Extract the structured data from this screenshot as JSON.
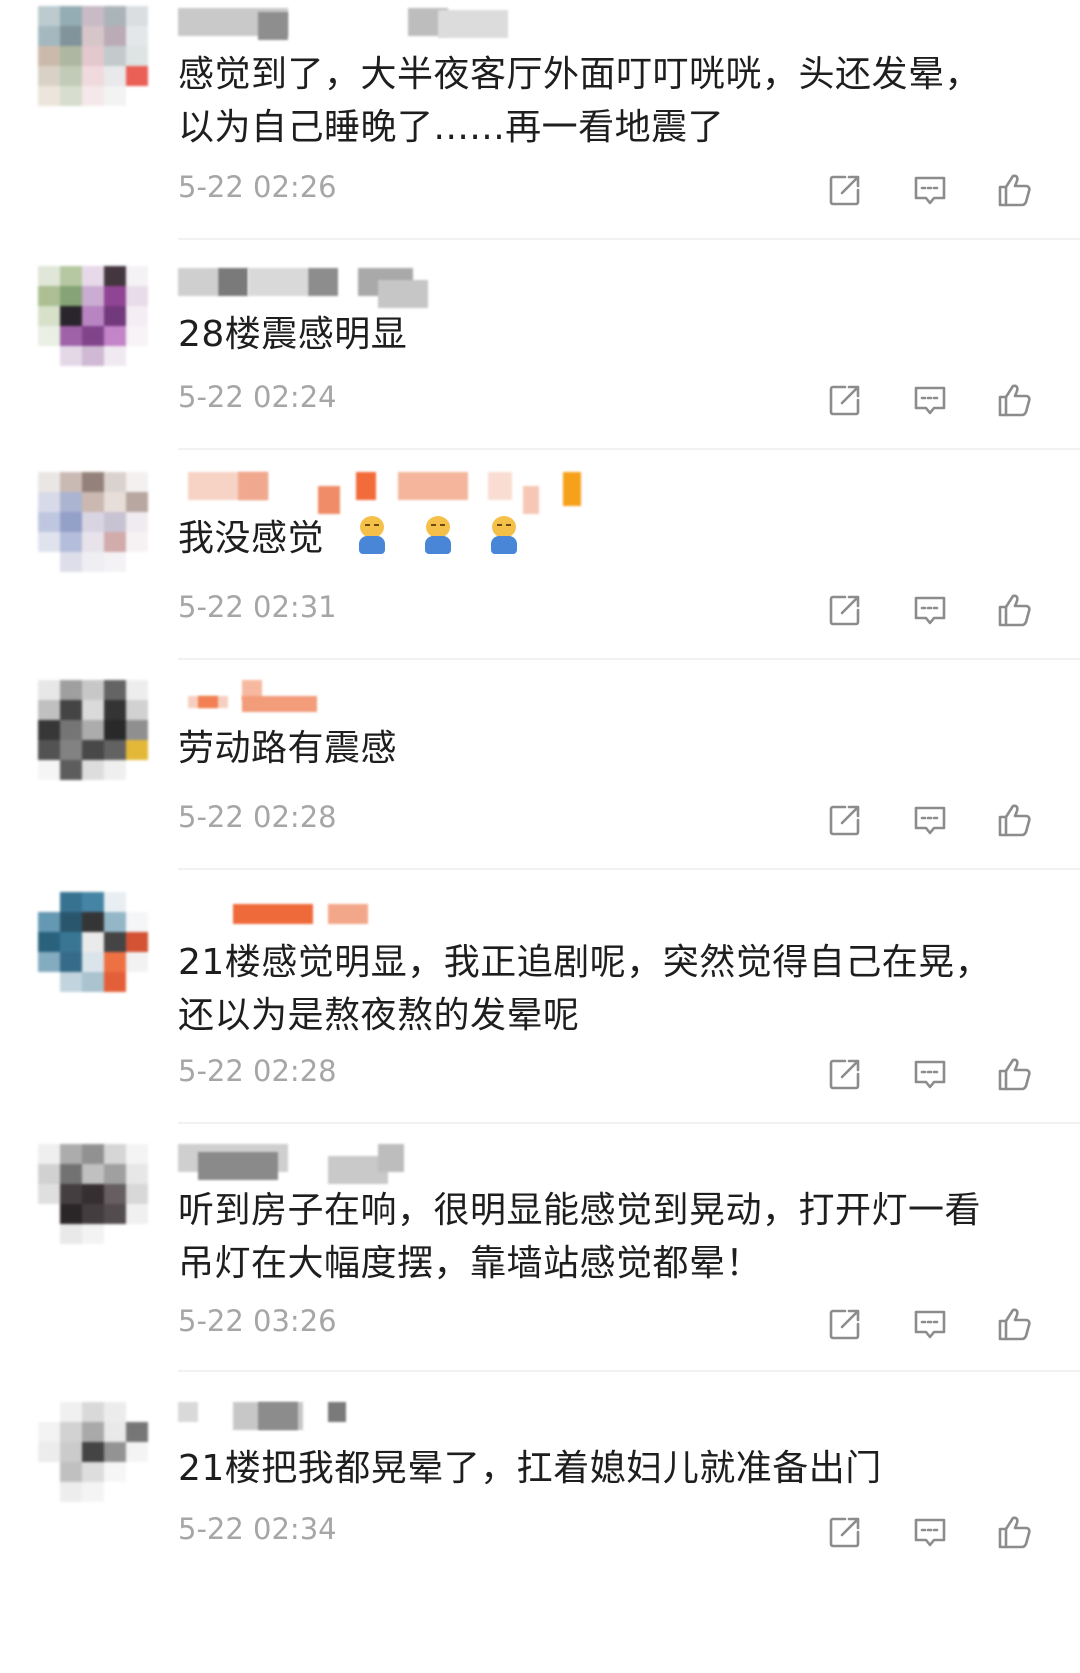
{
  "colors": {
    "text": "#1e1e1e",
    "time": "#a6a6a6",
    "icon": "#8c8c8c",
    "divider": "#f2f2f2"
  },
  "icons": {
    "share": "share-icon",
    "reply": "comment-icon",
    "like": "thumbs-up-icon"
  },
  "comments": [
    {
      "text_line1": "感觉到了，大半夜客厅外面叮叮咣咣，头还发晕，",
      "text_line2": "以为自己睡晚了......再一看地震了",
      "time": "5-22 02:26"
    },
    {
      "text_line1": "28楼震感明显",
      "time": "5-22 02:24"
    },
    {
      "text_line1": "我没感觉",
      "time": "5-22 02:31"
    },
    {
      "text_line1": "劳动路有震感",
      "time": "5-22 02:28"
    },
    {
      "text_line1": "21楼感觉明显，我正追剧呢，突然觉得自己在晃，",
      "text_line2": "还以为是熬夜熬的发晕呢",
      "time": "5-22 02:28"
    },
    {
      "text_line1": "听到房子在响，很明显能感觉到晃动，打开灯一看",
      "text_line2": "吊灯在大幅度摆，靠墙站感觉都晕！",
      "time": "5-22 03:26"
    },
    {
      "text_line1": "21楼把我都晃晕了，扛着媳妇儿就准备出门",
      "time": "5-22 02:34"
    }
  ]
}
